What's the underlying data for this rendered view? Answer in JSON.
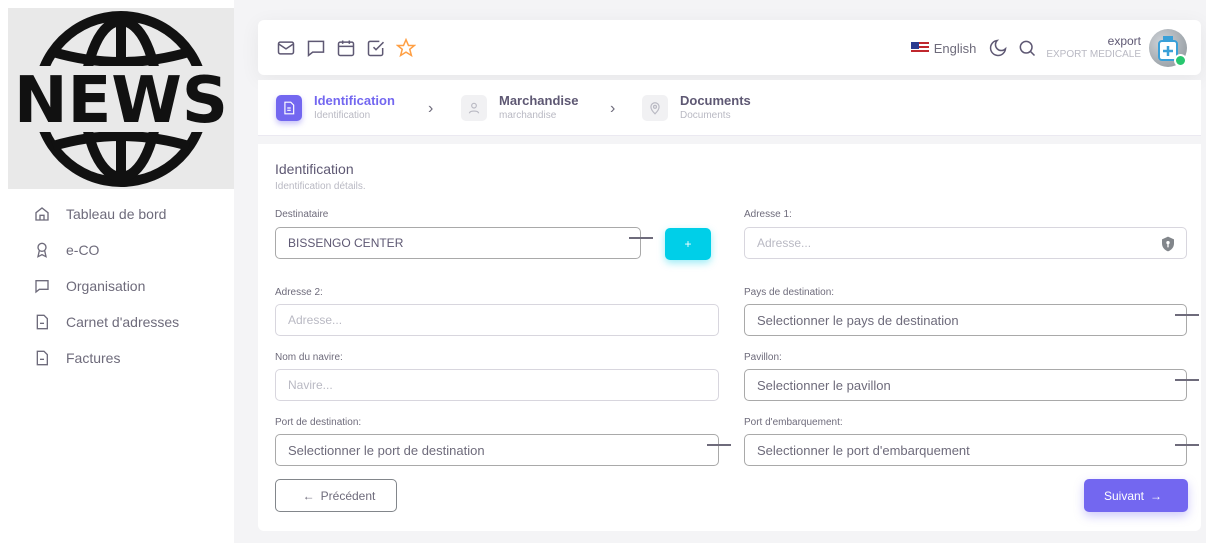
{
  "logo": {
    "text": "NEWS"
  },
  "sidebar": {
    "items": [
      {
        "label": "Tableau de bord",
        "icon": "home-icon"
      },
      {
        "label": "e-CO",
        "icon": "award-icon"
      },
      {
        "label": "Organisation",
        "icon": "message-square-icon"
      },
      {
        "label": "Carnet d'adresses",
        "icon": "file-icon"
      },
      {
        "label": "Factures",
        "icon": "file-icon"
      }
    ]
  },
  "navbar": {
    "icons": [
      "mail-icon",
      "message-square-icon",
      "calendar-icon",
      "check-square-icon",
      "star-icon"
    ],
    "language": "English",
    "user_name": "export",
    "user_role": "EXPORT MEDICALE"
  },
  "stepper": {
    "steps": [
      {
        "title": "Identification",
        "subtitle": "Identification",
        "icon": "file-text-icon",
        "active": true
      },
      {
        "title": "Marchandise",
        "subtitle": "marchandise",
        "icon": "user-icon",
        "active": false
      },
      {
        "title": "Documents",
        "subtitle": "Documents",
        "icon": "map-pin-icon",
        "active": false
      }
    ]
  },
  "form": {
    "title": "Identification",
    "subtitle": "Identification détails.",
    "destinataire": {
      "label": "Destinataire",
      "value": "BISSENGO CENTER"
    },
    "add_button": "+",
    "adresse1": {
      "label": "Adresse 1:",
      "placeholder": "Adresse..."
    },
    "adresse2": {
      "label": "Adresse 2:",
      "placeholder": "Adresse..."
    },
    "pays": {
      "label": "Pays de destination:",
      "placeholder": "Selectionner le pays de destination"
    },
    "navire": {
      "label": "Nom du navire:",
      "placeholder": "Navire..."
    },
    "pavillon": {
      "label": "Pavillon:",
      "placeholder": "Selectionner le pavillon"
    },
    "port_destination": {
      "label": "Port de destination:",
      "placeholder": "Selectionner le port de destination"
    },
    "port_embarquement": {
      "label": "Port d'embarquement:",
      "placeholder": "Selectionner le port d'embarquement"
    },
    "prev_button": "Précédent",
    "prev_arrow": "←",
    "next_button": "Suivant",
    "next_arrow": "→"
  },
  "colors": {
    "primary": "#7367f0",
    "info": "#00cfe8",
    "success": "#28c76f"
  }
}
